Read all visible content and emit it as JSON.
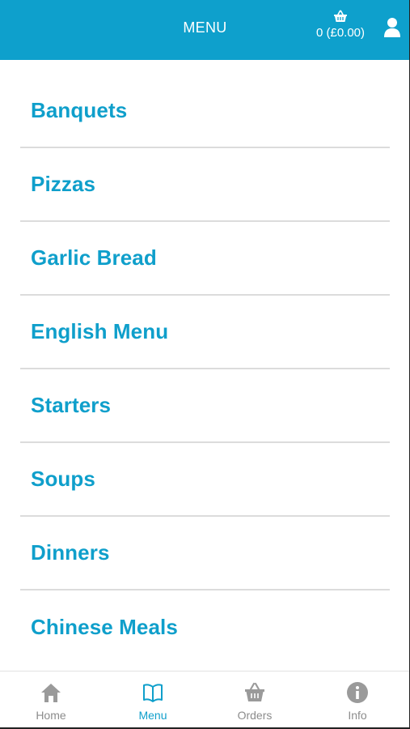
{
  "header": {
    "title": "MENU",
    "basket_text": "0 (£0.00)",
    "basket_icon": "basket-icon",
    "user_icon": "user-icon"
  },
  "menu": {
    "items": [
      {
        "label": "Banquets"
      },
      {
        "label": "Pizzas"
      },
      {
        "label": "Garlic Bread"
      },
      {
        "label": "English Menu"
      },
      {
        "label": "Starters"
      },
      {
        "label": "Soups"
      },
      {
        "label": "Dinners"
      },
      {
        "label": "Chinese Meals"
      }
    ]
  },
  "nav": {
    "items": [
      {
        "label": "Home",
        "icon": "home-icon",
        "active": false
      },
      {
        "label": "Menu",
        "icon": "book-icon",
        "active": true
      },
      {
        "label": "Orders",
        "icon": "basket-icon",
        "active": false
      },
      {
        "label": "Info",
        "icon": "info-icon",
        "active": false
      }
    ]
  },
  "colors": {
    "accent": "#0ea0cc",
    "inactive": "#9a9a9a",
    "divider": "#dcdcdc"
  }
}
